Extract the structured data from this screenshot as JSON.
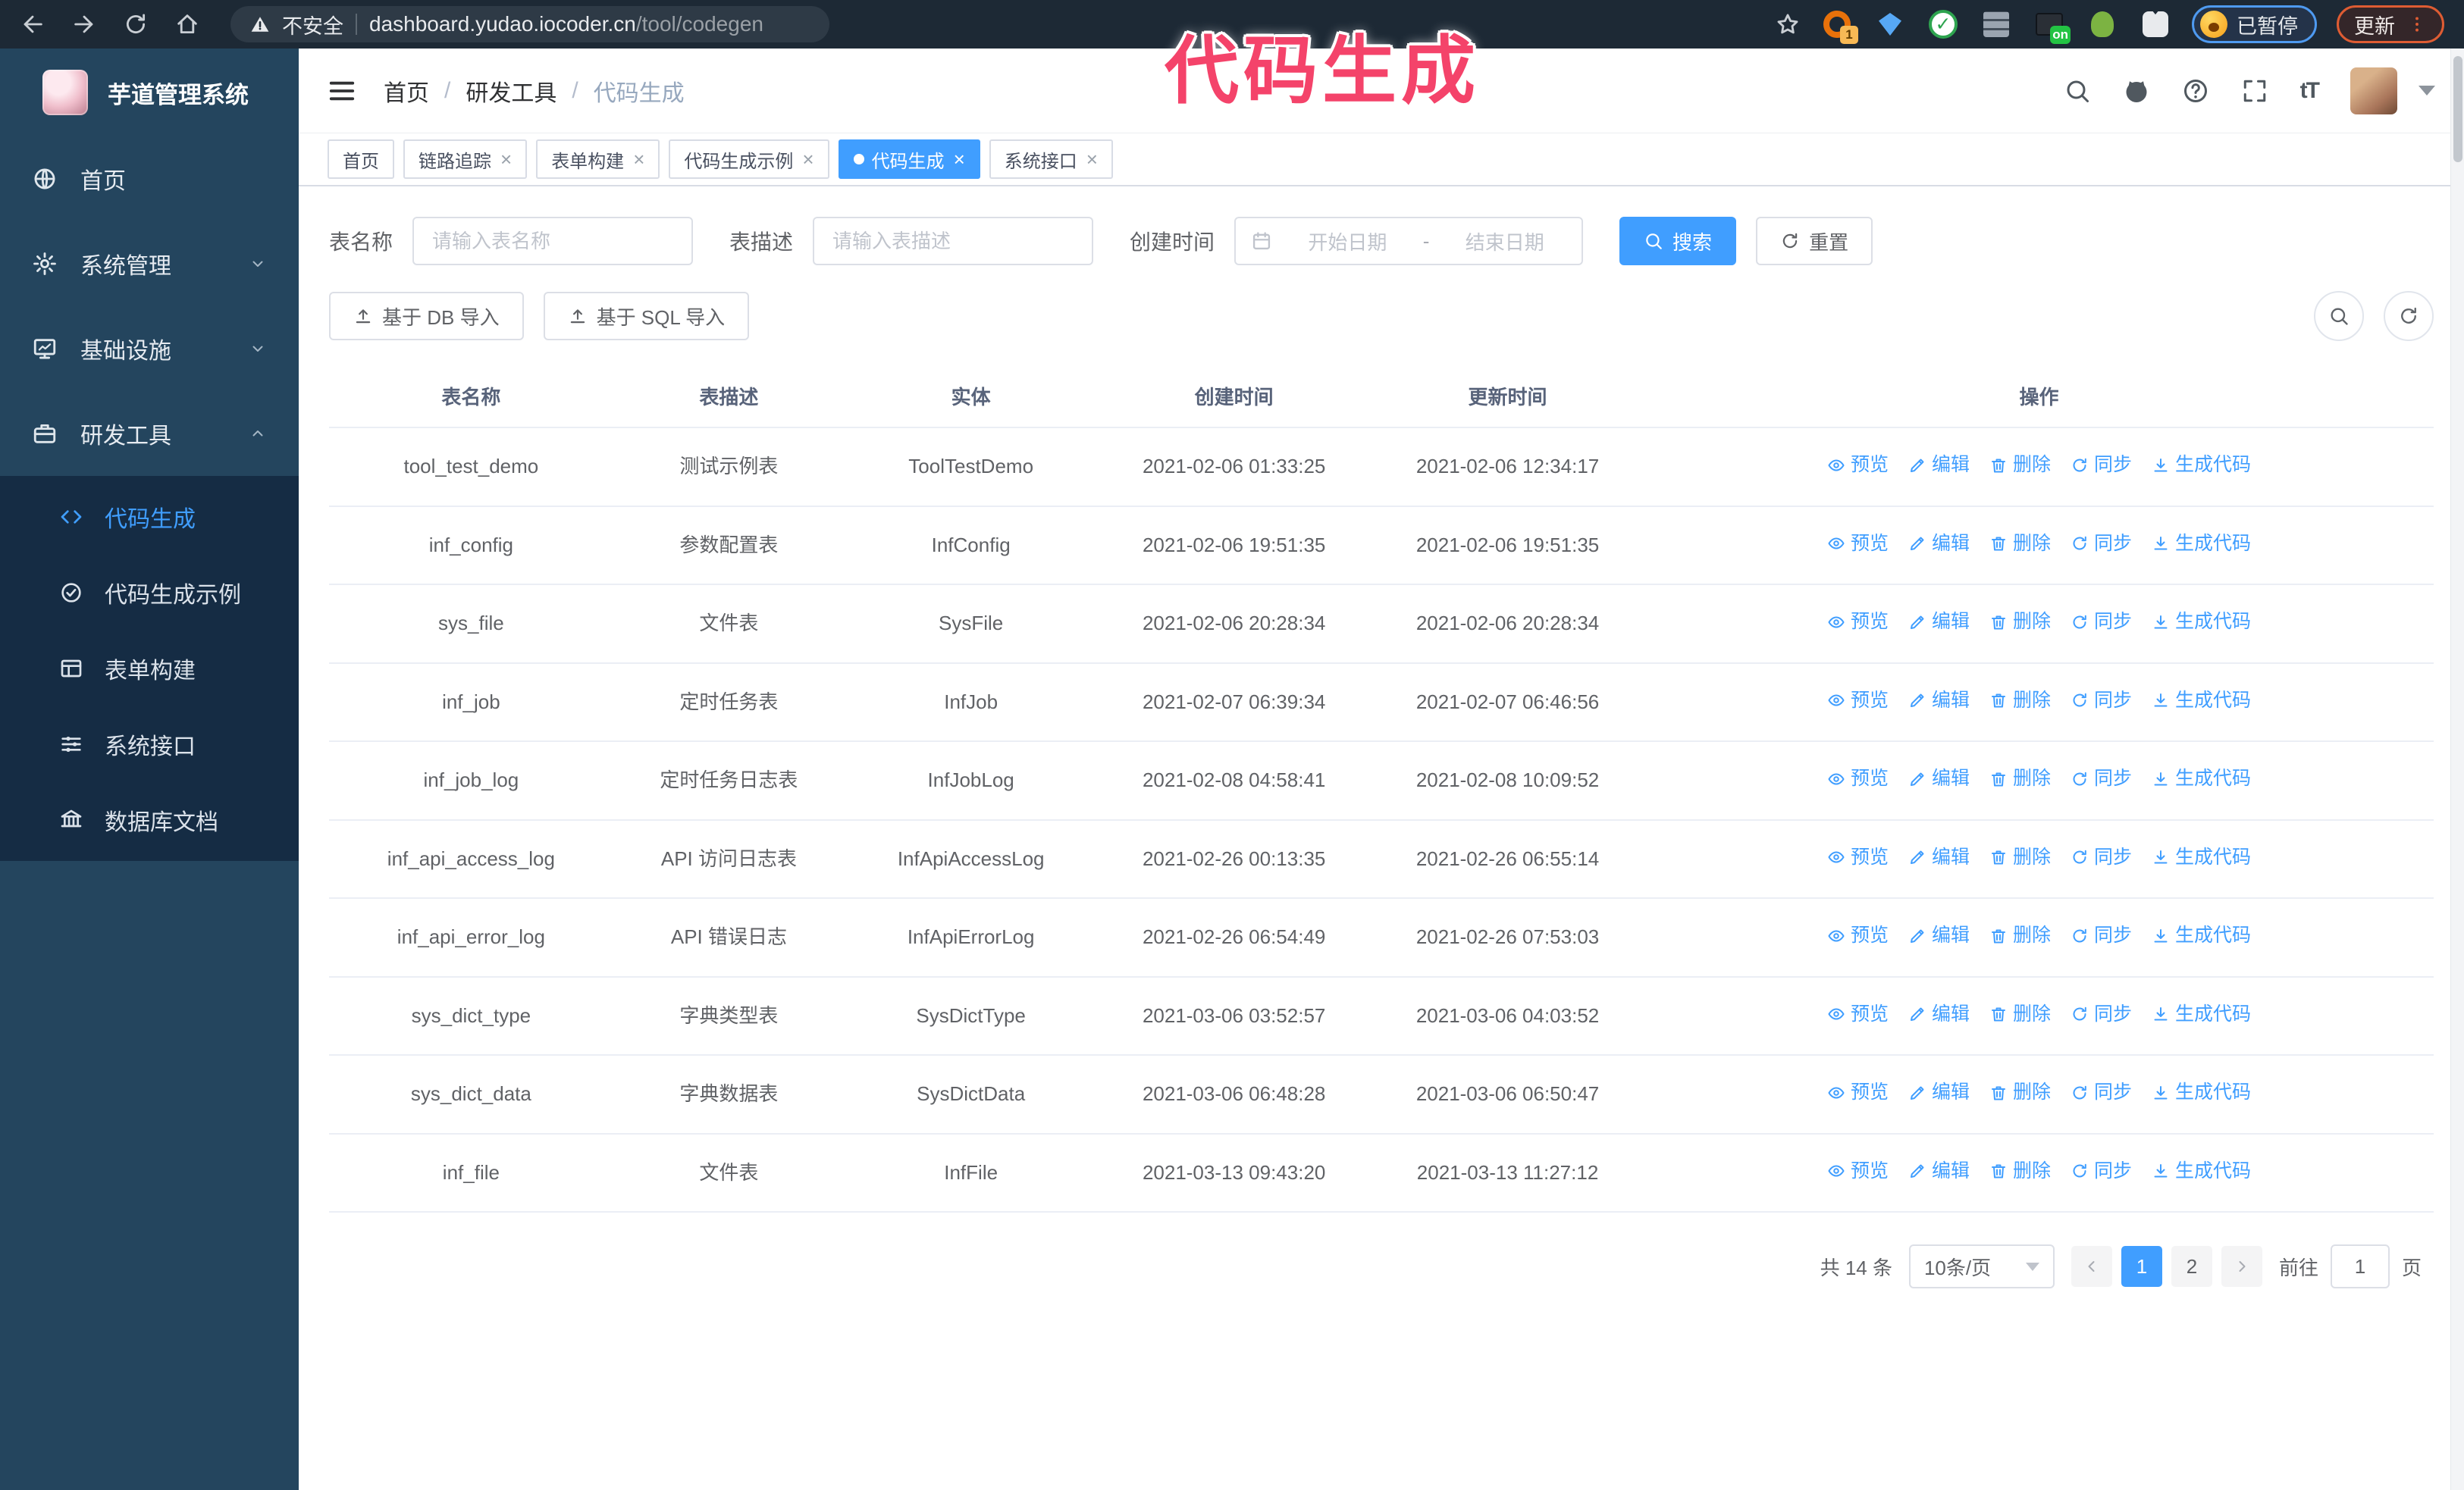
{
  "browser": {
    "security_label": "不安全",
    "url_host": "dashboard.yudao.iocoder.cn",
    "url_path": "/tool/codegen",
    "ext_badge_1": "1",
    "ext_badge_on": "on",
    "paused_badge": "已暂停",
    "update_button": "更新"
  },
  "overlay_title": "代码生成",
  "colors": {
    "accent": "#409eff",
    "sidebar_bg": "#24455e",
    "submenu_bg": "#152c44",
    "title_pink": "#f4436a"
  },
  "sidebar": {
    "logo_title": "芋道管理系统",
    "menu": [
      {
        "id": "home",
        "label": "首页",
        "icon": "globe-icon"
      },
      {
        "id": "system",
        "label": "系统管理",
        "icon": "gear-icon",
        "chevron": "down"
      },
      {
        "id": "infra",
        "label": "基础设施",
        "icon": "monitor-icon",
        "chevron": "down"
      },
      {
        "id": "devtools",
        "label": "研发工具",
        "icon": "briefcase-icon",
        "chevron": "up",
        "expanded": true
      }
    ],
    "submenu": [
      {
        "id": "codegen",
        "label": "代码生成",
        "icon": "code-icon",
        "active": true
      },
      {
        "id": "codegen-example",
        "label": "代码生成示例",
        "icon": "badge-check-icon"
      },
      {
        "id": "form-build",
        "label": "表单构建",
        "icon": "form-icon"
      },
      {
        "id": "system-api",
        "label": "系统接口",
        "icon": "sliders-icon"
      },
      {
        "id": "db-doc",
        "label": "数据库文档",
        "icon": "columns-icon"
      }
    ]
  },
  "header": {
    "breadcrumb": [
      "首页",
      "研发工具",
      "代码生成"
    ],
    "tabs": [
      {
        "label": "首页",
        "closable": false,
        "active": false
      },
      {
        "label": "链路追踪",
        "closable": true,
        "active": false
      },
      {
        "label": "表单构建",
        "closable": true,
        "active": false
      },
      {
        "label": "代码生成示例",
        "closable": true,
        "active": false
      },
      {
        "label": "代码生成",
        "closable": true,
        "active": true
      },
      {
        "label": "系统接口",
        "closable": true,
        "active": false
      }
    ]
  },
  "filters": {
    "table_name": {
      "label": "表名称",
      "placeholder": "请输入表名称"
    },
    "table_desc": {
      "label": "表描述",
      "placeholder": "请输入表描述"
    },
    "create_time": {
      "label": "创建时间",
      "start_placeholder": "开始日期",
      "separator": "-",
      "end_placeholder": "结束日期"
    },
    "search_button": "搜索",
    "reset_button": "重置"
  },
  "toolbar": {
    "import_db_button": "基于 DB 导入",
    "import_sql_button": "基于 SQL 导入"
  },
  "table": {
    "columns": [
      "表名称",
      "表描述",
      "实体",
      "创建时间",
      "更新时间",
      "操作"
    ],
    "actions": [
      {
        "id": "preview",
        "icon": "eye-icon",
        "label": "预览"
      },
      {
        "id": "edit",
        "icon": "edit-icon",
        "label": "编辑"
      },
      {
        "id": "delete",
        "icon": "delete-icon",
        "label": "删除"
      },
      {
        "id": "sync",
        "icon": "sync-icon",
        "label": "同步"
      },
      {
        "id": "generate",
        "icon": "download-icon",
        "label": "生成代码"
      }
    ],
    "rows": [
      {
        "name": "tool_test_demo",
        "desc": "测试示例表",
        "entity": "ToolTestDemo",
        "created": "2021-02-06 01:33:25",
        "updated": "2021-02-06 12:34:17"
      },
      {
        "name": "inf_config",
        "desc": "参数配置表",
        "entity": "InfConfig",
        "created": "2021-02-06 19:51:35",
        "updated": "2021-02-06 19:51:35"
      },
      {
        "name": "sys_file",
        "desc": "文件表",
        "entity": "SysFile",
        "created": "2021-02-06 20:28:34",
        "updated": "2021-02-06 20:28:34"
      },
      {
        "name": "inf_job",
        "desc": "定时任务表",
        "entity": "InfJob",
        "created": "2021-02-07 06:39:34",
        "updated": "2021-02-07 06:46:56"
      },
      {
        "name": "inf_job_log",
        "desc": "定时任务日志表",
        "entity": "InfJobLog",
        "created": "2021-02-08 04:58:41",
        "updated": "2021-02-08 10:09:52"
      },
      {
        "name": "inf_api_access_log",
        "desc": "API 访问日志表",
        "entity": "InfApiAccessLog",
        "created": "2021-02-26 00:13:35",
        "updated": "2021-02-26 06:55:14"
      },
      {
        "name": "inf_api_error_log",
        "desc": "API 错误日志",
        "entity": "InfApiErrorLog",
        "created": "2021-02-26 06:54:49",
        "updated": "2021-02-26 07:53:03"
      },
      {
        "name": "sys_dict_type",
        "desc": "字典类型表",
        "entity": "SysDictType",
        "created": "2021-03-06 03:52:57",
        "updated": "2021-03-06 04:03:52"
      },
      {
        "name": "sys_dict_data",
        "desc": "字典数据表",
        "entity": "SysDictData",
        "created": "2021-03-06 06:48:28",
        "updated": "2021-03-06 06:50:47"
      },
      {
        "name": "inf_file",
        "desc": "文件表",
        "entity": "InfFile",
        "created": "2021-03-13 09:43:20",
        "updated": "2021-03-13 11:27:12"
      }
    ]
  },
  "pagination": {
    "total_text": "共 14 条",
    "page_size": "10条/页",
    "pages": [
      "1",
      "2"
    ],
    "active_page": "1",
    "goto_label": "前往",
    "goto_value": "1",
    "goto_suffix": "页"
  }
}
